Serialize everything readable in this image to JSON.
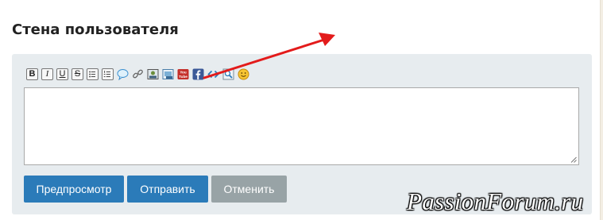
{
  "header": {
    "title": "Стена пользователя"
  },
  "toolbar": {
    "items": [
      {
        "name": "bold",
        "glyph": "B"
      },
      {
        "name": "italic",
        "glyph": "I"
      },
      {
        "name": "underline",
        "glyph": "U"
      },
      {
        "name": "strikethrough",
        "glyph": "S"
      },
      {
        "name": "bulleted-list"
      },
      {
        "name": "numbered-list"
      },
      {
        "name": "quote"
      },
      {
        "name": "link"
      },
      {
        "name": "image"
      },
      {
        "name": "gallery-image"
      },
      {
        "name": "youtube",
        "glyph": "You Tube"
      },
      {
        "name": "facebook",
        "glyph": "f"
      },
      {
        "name": "code",
        "glyph": "<>"
      },
      {
        "name": "spoiler"
      },
      {
        "name": "smiley"
      }
    ]
  },
  "editor": {
    "value": "",
    "placeholder": ""
  },
  "buttons": {
    "preview": "Предпросмотр",
    "submit": "Отправить",
    "cancel": "Отменить"
  },
  "watermark": "PassionForum.ru",
  "colors": {
    "primary": "#2b7bb9",
    "secondary": "#98a3a6",
    "panel": "#e7ecef",
    "arrow": "#e31b1b"
  }
}
